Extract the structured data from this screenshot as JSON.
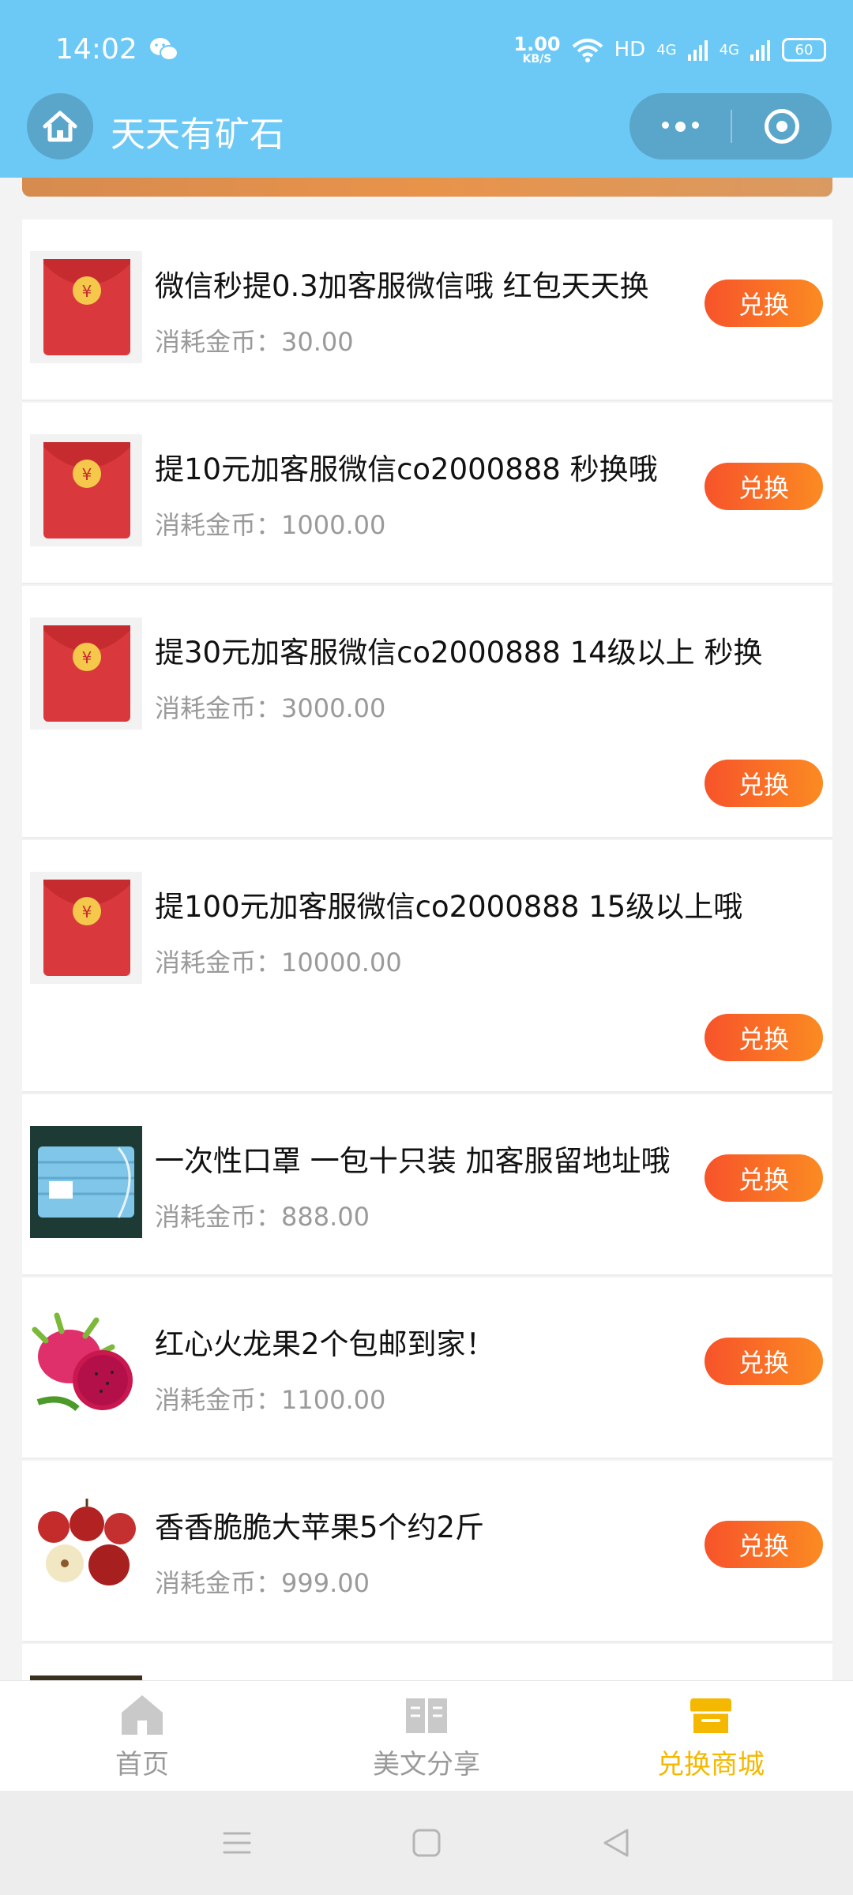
{
  "status_bar": {
    "time": "14:02",
    "speed_value": "1.00",
    "speed_unit": "KB/S",
    "network": "HD",
    "signal1": "4G",
    "signal2": "4G",
    "battery": "60",
    "wechat_icon": "wechat-icon"
  },
  "header": {
    "title": "天天有矿石",
    "home_icon": "home-icon",
    "more_icon": "more-icon",
    "close_icon": "close-icon",
    "background_color": "#6cc9f5"
  },
  "products": [
    {
      "title": "微信秒提0.3加客服微信哦 红包天天换",
      "cost": "消耗金币：30.00",
      "button": "兑换",
      "image": "red-envelope"
    },
    {
      "title": "提10元加客服微信co2000888 秒换哦",
      "cost": "消耗金币：1000.00",
      "button": "兑换",
      "image": "red-envelope"
    },
    {
      "title": "提30元加客服微信co2000888 14级以上 秒换",
      "cost": "消耗金币：3000.00",
      "button": "兑换",
      "image": "red-envelope"
    },
    {
      "title": "提100元加客服微信co2000888 15级以上哦",
      "cost": "消耗金币：10000.00",
      "button": "兑换",
      "image": "red-envelope"
    },
    {
      "title": "一次性口罩 一包十只装 加客服留地址哦",
      "cost": "消耗金币：888.00",
      "button": "兑换",
      "image": "face-masks"
    },
    {
      "title": "红心火龙果2个包邮到家！",
      "cost": "消耗金币：1100.00",
      "button": "兑换",
      "image": "dragon-fruit"
    },
    {
      "title": "香香脆脆大苹果5个约2斤",
      "cost": "消耗金币：999.00",
      "button": "兑换",
      "image": "apples"
    }
  ],
  "tabbar": {
    "items": [
      {
        "label": "首页",
        "icon": "home-icon",
        "active": false
      },
      {
        "label": "美文分享",
        "icon": "book-icon",
        "active": false
      },
      {
        "label": "兑换商城",
        "icon": "store-icon",
        "active": true
      }
    ],
    "active_color": "#f5b800"
  },
  "system_nav": {
    "menu_icon": "menu-icon",
    "home_icon": "square-icon",
    "back_icon": "back-icon"
  },
  "accent_colors": {
    "button_start": "#f7532a",
    "button_end": "#fb8b22"
  }
}
